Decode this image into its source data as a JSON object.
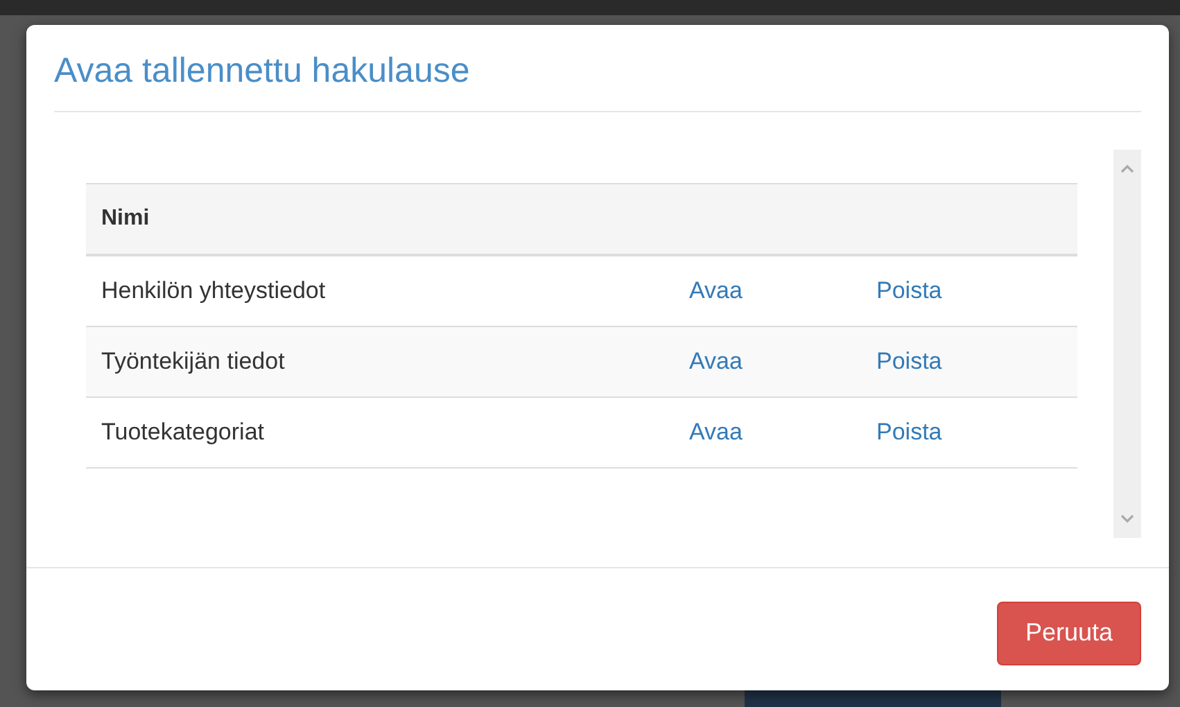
{
  "dialog": {
    "title": "Avaa tallennettu hakulause"
  },
  "table": {
    "columns": [
      "Nimi"
    ],
    "rows": [
      {
        "name": "Henkilön yhteystiedot",
        "open": "Avaa",
        "delete": "Poista"
      },
      {
        "name": "Työntekijän tiedot",
        "open": "Avaa",
        "delete": "Poista"
      },
      {
        "name": "Tuotekategoriat",
        "open": "Avaa",
        "delete": "Poista"
      }
    ]
  },
  "buttons": [
    "Peruuta"
  ]
}
